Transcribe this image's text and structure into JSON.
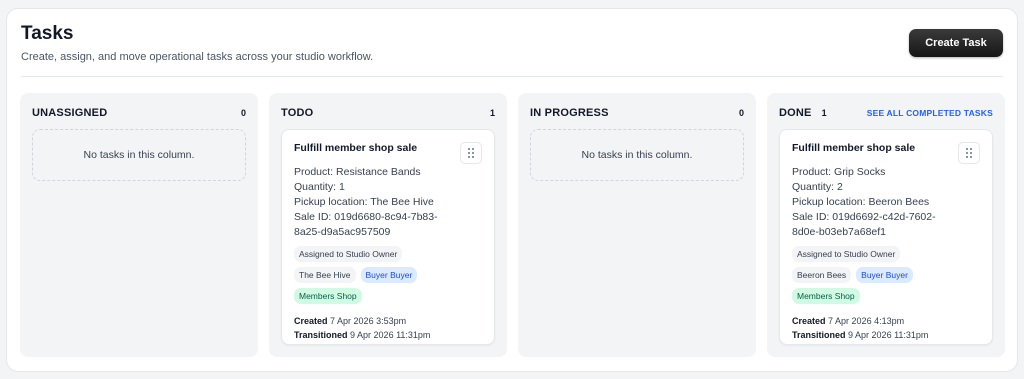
{
  "header": {
    "title": "Tasks",
    "subtitle": "Create, assign, and move operational tasks across your studio workflow.",
    "create_label": "Create Task"
  },
  "columns": [
    {
      "title": "UNASSIGNED",
      "count": "0",
      "empty_text": "No tasks in this column."
    },
    {
      "title": "TODO",
      "count": "1",
      "card": {
        "title": "Fulfill member shop sale",
        "product": "Product: Resistance Bands",
        "quantity": "Quantity: 1",
        "pickup": "Pickup location: The Bee Hive",
        "sale_id_1": "Sale ID: 019d6680-8c94-7b83-",
        "sale_id_2": "8a25-d9a5ac957509",
        "assigned": "Assigned to Studio Owner",
        "location_tag": "The Bee Hive",
        "buyer_tag": "Buyer Buyer",
        "source_tag": "Members Shop",
        "created_label": "Created",
        "created_value": "7 Apr 2026 3:53pm",
        "transitioned_label": "Transitioned",
        "transitioned_value": "9 Apr 2026 11:31pm",
        "drag_icon": "drag-handle-icon"
      }
    },
    {
      "title": "IN PROGRESS",
      "count": "0",
      "empty_text": "No tasks in this column."
    },
    {
      "title": "DONE",
      "count": "1",
      "see_all": "SEE ALL COMPLETED TASKS",
      "card": {
        "title": "Fulfill member shop sale",
        "product": "Product: Grip Socks",
        "quantity": "Quantity: 2",
        "pickup": "Pickup location: Beeron Bees",
        "sale_id_1": "Sale ID: 019d6692-c42d-7602-",
        "sale_id_2": "8d0e-b03eb7a68ef1",
        "assigned": "Assigned to Studio Owner",
        "location_tag": "Beeron Bees",
        "buyer_tag": "Buyer Buyer",
        "source_tag": "Members Shop",
        "created_label": "Created",
        "created_value": "7 Apr 2026 4:13pm",
        "transitioned_label": "Transitioned",
        "transitioned_value": "9 Apr 2026 11:31pm",
        "drag_icon": "drag-handle-icon"
      }
    }
  ],
  "colors": {
    "accent_link": "#2563eb",
    "buyer_tag_bg": "#dbeafe",
    "shop_tag_bg": "#d1fae5",
    "button_bg": "#1f1f1f"
  }
}
